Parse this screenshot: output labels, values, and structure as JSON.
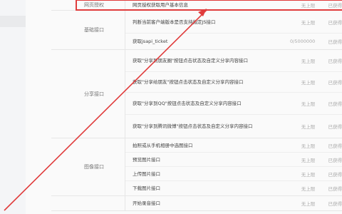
{
  "table": {
    "groups": [
      {
        "label": "网页授权",
        "rows": [
          {
            "name": "网页授权获取用户基本信息",
            "quota": "无上限",
            "status": "已获得"
          }
        ]
      },
      {
        "label": "基础接口",
        "rows": [
          {
            "name": "判断当前客户端版本是否支持指定JS接口",
            "quota": "无上限",
            "status": "已获得"
          },
          {
            "name": "获取jsapi_ticket",
            "quota": "0/5000000",
            "status": "已获得"
          }
        ]
      },
      {
        "label": "分享接口",
        "rows": [
          {
            "name": "获取\"分享到朋友圈\"按钮点击状态及自定义分享内容接口",
            "quota": "无上限",
            "status": "已获得"
          },
          {
            "name": "获取\"分享给朋友\"按钮点击状态及自定义分享内容接口",
            "quota": "无上限",
            "status": "已获得"
          },
          {
            "name": "获取\"分享到QQ\"按钮点击状态及自定义分享内容接口",
            "quota": "无上限",
            "status": "已获得"
          },
          {
            "name": "获取\"分享到腾讯微博\"按钮点击状态及自定义分享内容接口",
            "quota": "无上限",
            "status": "已获得"
          }
        ]
      },
      {
        "label": "图像接口",
        "rows": [
          {
            "name": "拍照或从手机相册中选图接口",
            "quota": "无上限",
            "status": "已获得"
          },
          {
            "name": "预览图片接口",
            "quota": "无上限",
            "status": "已获得"
          },
          {
            "name": "上传图片接口",
            "quota": "无上限",
            "status": "已获得"
          },
          {
            "name": "下载图片接口",
            "quota": "无上限",
            "status": "已获得"
          }
        ]
      },
      {
        "label": "",
        "rows": [
          {
            "name": "开始录音接口",
            "quota": "无上限",
            "status": "已获得"
          }
        ]
      }
    ]
  },
  "annotation": {
    "color": "#e03c3c"
  }
}
